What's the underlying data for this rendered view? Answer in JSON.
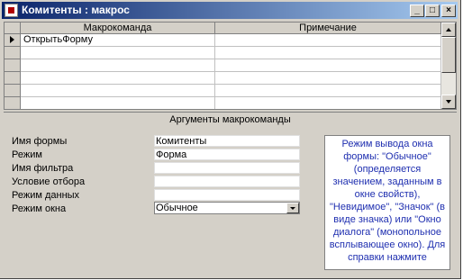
{
  "window": {
    "title": "Комитенты : макрос",
    "buttons": {
      "minimize": "_",
      "maximize": "□",
      "close": "×"
    }
  },
  "grid": {
    "columns": [
      "Макрокоманда",
      "Примечание"
    ],
    "rows": [
      {
        "action": "ОткрытьФорму",
        "note": "",
        "current": true
      },
      {
        "action": "",
        "note": ""
      },
      {
        "action": "",
        "note": ""
      },
      {
        "action": "",
        "note": ""
      },
      {
        "action": "",
        "note": ""
      },
      {
        "action": "",
        "note": ""
      }
    ]
  },
  "arguments": {
    "title": "Аргументы макрокоманды",
    "items": [
      {
        "label": "Имя формы",
        "value": "Комитенты"
      },
      {
        "label": "Режим",
        "value": "Форма"
      },
      {
        "label": "Имя фильтра",
        "value": ""
      },
      {
        "label": "Условие отбора",
        "value": ""
      },
      {
        "label": "Режим данных",
        "value": ""
      },
      {
        "label": "Режим окна",
        "value": "Обычное"
      }
    ]
  },
  "help_text": "Режим вывода окна формы: \"Обычное\" (определяется значением, заданным в окне свойств), \"Невидимое\", \"Значок\" (в виде значка) или \"Окно диалога\" (монопольное всплывающее окно). Для справки нажмите",
  "colors": {
    "title_start": "#0a246a",
    "title_end": "#a6caf0",
    "help_text": "#1f2fb0"
  }
}
